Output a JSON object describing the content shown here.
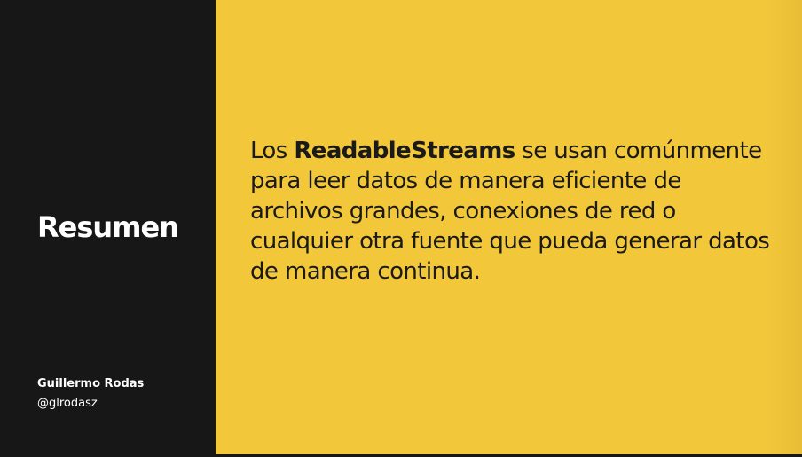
{
  "slide": {
    "title": "Resumen",
    "author": {
      "name": "Guillermo Rodas",
      "handle": "@glrodasz"
    },
    "body": {
      "prefix": "Los ",
      "highlight": "ReadableStreams",
      "suffix": " se usan comúnmente para leer datos de manera eficiente de archivos grandes, conexiones de red o cualquier otra fuente que pueda generar datos de manera continua."
    }
  },
  "colors": {
    "left_panel": "#171717",
    "accent_background": "#f2c73a",
    "text_dark": "#1a1a1a",
    "text_light": "#ffffff"
  }
}
